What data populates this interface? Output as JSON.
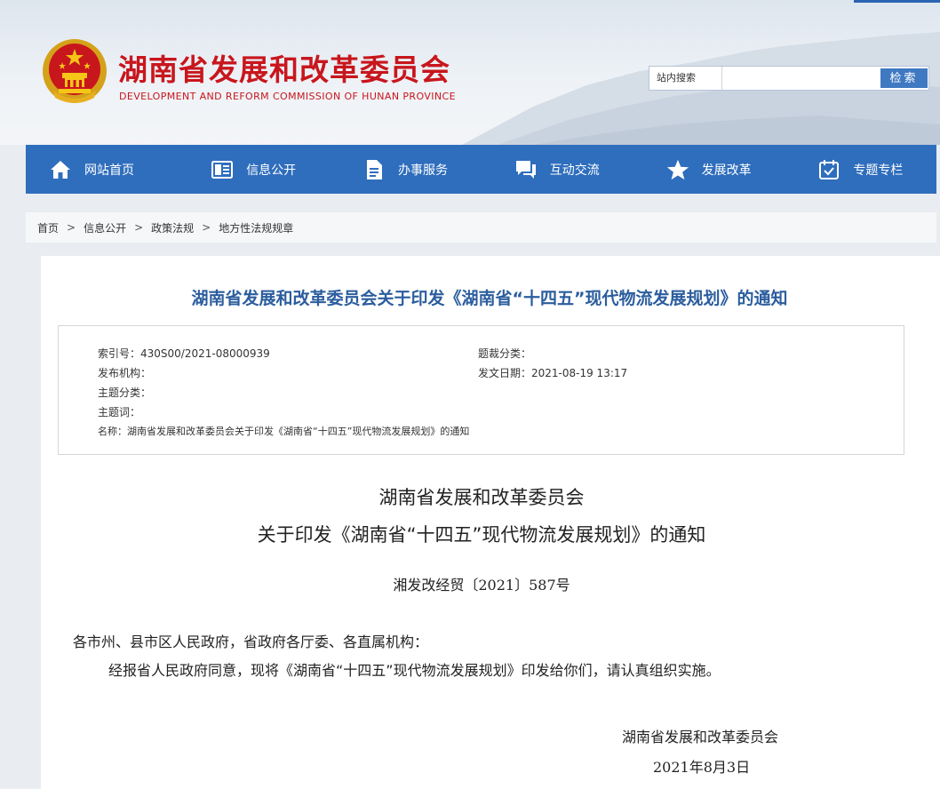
{
  "site": {
    "title": "湖南省发展和改革委员会",
    "subtitle": "DEVELOPMENT AND REFORM COMMISSION OF HUNAN PROVINCE"
  },
  "search": {
    "label": "站内搜索",
    "placeholder": "",
    "button": "检索"
  },
  "nav": [
    {
      "label": "网站首页",
      "icon": "home-icon"
    },
    {
      "label": "信息公开",
      "icon": "document-list-icon"
    },
    {
      "label": "办事服务",
      "icon": "file-icon"
    },
    {
      "label": "互动交流",
      "icon": "chat-icon"
    },
    {
      "label": "发展改革",
      "icon": "star-icon"
    },
    {
      "label": "专题专栏",
      "icon": "calendar-check-icon"
    }
  ],
  "breadcrumb": [
    "首页",
    "信息公开",
    "政策法规",
    "地方性法规规章"
  ],
  "breadcrumb_sep": ">",
  "doc": {
    "title": "湖南省发展和改革委员会关于印发《湖南省“十四五”现代物流发展规划》的通知",
    "meta": {
      "index_no": "索引号：430S00/2021-08000939",
      "category": "题裁分类：",
      "publisher": "发布机构：",
      "date": "发文日期：2021-08-19 13:17",
      "topic": "主题分类：",
      "keywords": "主题词：",
      "name": "名称：湖南省发展和改革委员会关于印发《湖南省“十四五”现代物流发展规划》的通知"
    },
    "body_title_1": "湖南省发展和改革委员会",
    "body_title_2": "关于印发《湖南省“十四五”现代物流发展规划》的通知",
    "doc_no": "湘发改经贸〔2021〕587号",
    "salutation": "各市州、县市区人民政府，省政府各厅委、各直属机构：",
    "paragraph": "经报省人民政府同意，现将《湖南省“十四五”现代物流发展规划》印发给你们，请认真组织实施。",
    "sign_org": "湖南省发展和改革委员会",
    "sign_date": "2021年8月3日"
  },
  "colors": {
    "brand_red": "#c8161d",
    "nav_blue": "#2f6ebd",
    "title_blue": "#2b5d9e"
  }
}
